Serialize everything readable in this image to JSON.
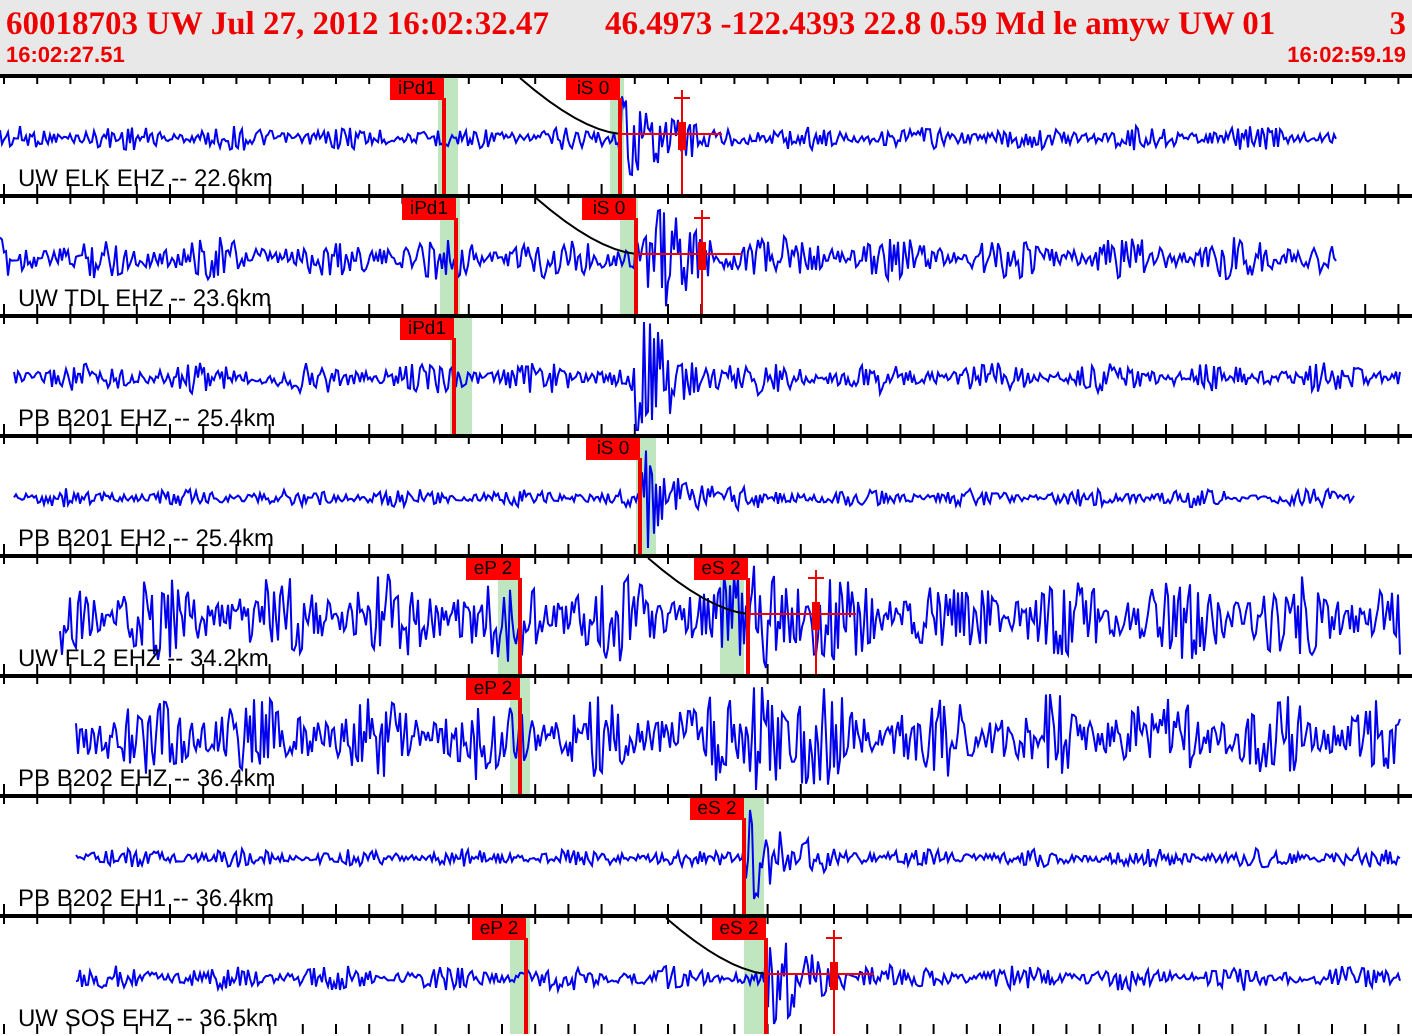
{
  "header": {
    "event_summary": "60018703 UW Jul 27, 2012 16:02:32.47",
    "location_summary": "46.4973 -122.4393 22.8 0.59 Md le amyw UW 01",
    "count": "3",
    "start_time": "16:02:27.51",
    "end_time": "16:02:59.19"
  },
  "traces": [
    {
      "label": "UW ELK EHZ -- 22.6km",
      "picks": [
        {
          "label": "iPd1",
          "kind": "p"
        },
        {
          "label": "iS 0",
          "kind": "s"
        }
      ]
    },
    {
      "label": "UW TDL EHZ -- 23.6km",
      "picks": [
        {
          "label": "iPd1",
          "kind": "p"
        },
        {
          "label": "iS 0",
          "kind": "s"
        }
      ]
    },
    {
      "label": "PB B201 EHZ -- 25.4km",
      "picks": [
        {
          "label": "iPd1",
          "kind": "p"
        }
      ]
    },
    {
      "label": "PB B201 EH2 -- 25.4km",
      "picks": [
        {
          "label": "iS 0",
          "kind": "s"
        }
      ]
    },
    {
      "label": "UW FL2 EHZ -- 34.2km",
      "picks": [
        {
          "label": "eP 2",
          "kind": "p"
        },
        {
          "label": "eS 2",
          "kind": "s"
        }
      ]
    },
    {
      "label": "PB B202 EHZ -- 36.4km",
      "picks": [
        {
          "label": "eP 2",
          "kind": "p"
        }
      ]
    },
    {
      "label": "PB B202 EH1 -- 36.4km",
      "picks": [
        {
          "label": "eS 2",
          "kind": "s"
        }
      ]
    },
    {
      "label": "UW SOS EHZ -- 36.5km",
      "picks": [
        {
          "label": "eP 2",
          "kind": "p"
        },
        {
          "label": "eS 2",
          "kind": "s"
        }
      ]
    }
  ]
}
